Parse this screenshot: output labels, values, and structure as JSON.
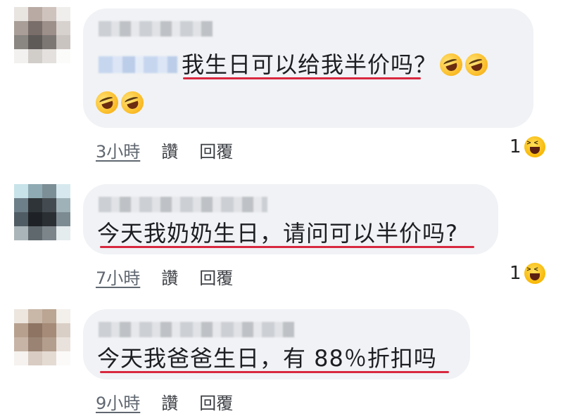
{
  "comments": [
    {
      "text": "我生日可以给我半价吗？",
      "text_line2": "",
      "emoji_line1": [
        "rolling-on-floor-laughing",
        "rolling-on-floor-laughing"
      ],
      "emoji_line2": [
        "rolling-on-floor-laughing",
        "rolling-on-floor-laughing"
      ],
      "time": "3小時",
      "like": "讚",
      "reply": "回覆",
      "reaction_count": "1"
    },
    {
      "text": "今天我奶奶生日，请问可以半价吗?",
      "time": "7小時",
      "like": "讚",
      "reply": "回覆",
      "reaction_count": "1"
    },
    {
      "text": "今天我爸爸生日，有 88％折扣吗",
      "time": "9小時",
      "like": "讚",
      "reply": "回覆"
    }
  ],
  "colors": {
    "bubble": "#f0f2f5",
    "underline": "#d8283e",
    "action_text": "#444950"
  },
  "icons": {
    "comment_emoji": "rolling-on-floor-laughing",
    "reaction_emoji": "laughing-face"
  }
}
